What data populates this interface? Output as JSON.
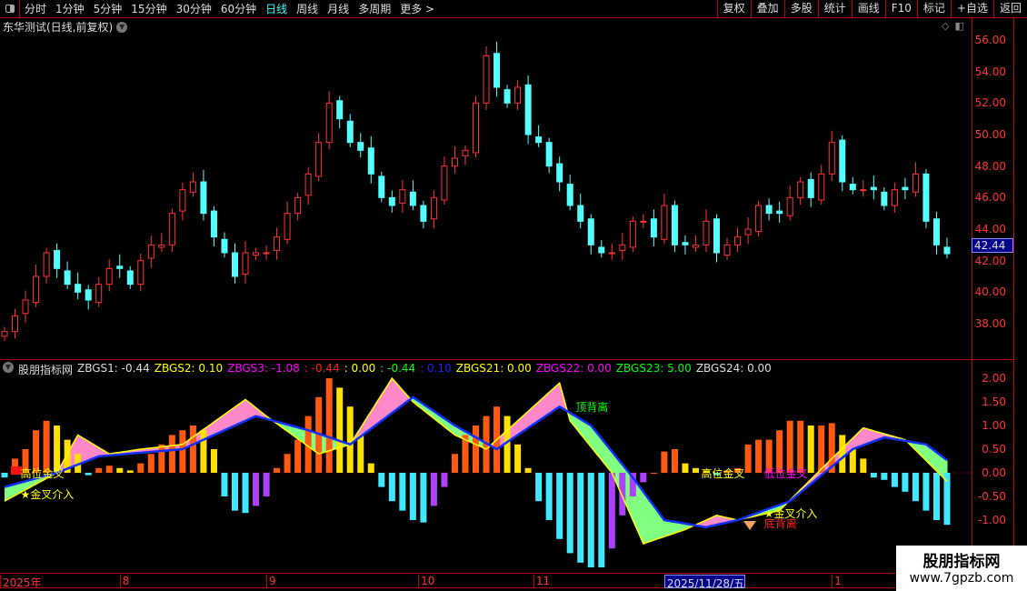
{
  "toolbar": {
    "periods": [
      "分时",
      "1分钟",
      "5分钟",
      "15分钟",
      "30分钟",
      "60分钟",
      "日线",
      "周线",
      "月线",
      "多周期",
      "更多 >"
    ],
    "active_period": "日线",
    "buttons": [
      "复权",
      "叠加",
      "多股",
      "统计",
      "画线",
      "F10",
      "标记",
      "+自选",
      "返回"
    ]
  },
  "chart": {
    "title": "东华测试(日线,前复权)",
    "current_price": "42.44",
    "price_ticks": [
      "56.00",
      "54.00",
      "52.00",
      "50.00",
      "48.00",
      "46.00",
      "44.00",
      "42.00",
      "40.00",
      "38.00"
    ],
    "price_range": [
      37,
      57.2
    ],
    "closes": [
      37.5,
      38.5,
      39.5,
      41,
      42.5,
      41.5,
      40.5,
      40,
      39.5,
      40.5,
      41.5,
      41.5,
      40.5,
      42,
      43,
      43,
      45,
      46.5,
      47,
      45,
      43.5,
      42.5,
      41,
      42.5,
      42.5,
      42.5,
      43.5,
      45,
      46,
      47.5,
      49.5,
      52,
      51,
      49.5,
      49,
      47.5,
      46,
      45.5,
      46.5,
      45.5,
      44.5,
      46,
      48,
      48.5,
      49,
      52,
      55,
      53,
      52,
      53,
      50,
      49.5,
      48,
      47,
      45.5,
      44.5,
      43,
      42.5,
      42.5,
      43,
      44.5,
      44.5,
      43.5,
      45.5,
      43,
      43,
      43,
      44.5,
      42.5,
      43,
      43.5,
      44,
      45.5,
      45,
      45,
      46,
      47,
      46,
      47.5,
      49.5,
      47,
      46.5,
      46.5,
      46.5,
      45.5,
      46.5,
      46.5,
      47.5,
      44.5,
      43,
      42.44
    ],
    "colors": {
      "up": "#ff3232",
      "down": "#54ffff"
    }
  },
  "indicator": {
    "name": "股朋指标网",
    "values": [
      {
        "label": "ZBGS1: -0.44",
        "color": "#dddddd"
      },
      {
        "label": "ZBGS2: 0.10",
        "color": "#ffff00"
      },
      {
        "label": "ZBGS3: -1.08",
        "color": "#ff00ff"
      },
      {
        "label": ": -0.44",
        "color": "#ff2020"
      },
      {
        "label": ": 0.00",
        "color": "#ffff00"
      },
      {
        "label": ": -0.44",
        "color": "#00ff00"
      },
      {
        "label": ": 0.10",
        "color": "#2020ff"
      },
      {
        "label": "ZBGS21: 0.00",
        "color": "#ffff00"
      },
      {
        "label": "ZBGS22: 0.00",
        "color": "#ff00ff"
      },
      {
        "label": "ZBGS23: 5.00",
        "color": "#00ff00"
      },
      {
        "label": "ZBGS24: 0.00",
        "color": "#dddddd"
      }
    ],
    "ticks": [
      "2.00",
      "1.50",
      "1.00",
      "0.50",
      "0.00",
      "-0.50",
      "-1.00"
    ],
    "range": [
      -2.1,
      2.2
    ],
    "histogram": [
      -0.1,
      0.3,
      0.5,
      0.9,
      1.1,
      1.0,
      0.7,
      0.4,
      -0.05,
      0.1,
      0.15,
      0.1,
      0.05,
      0.2,
      0.4,
      0.6,
      0.8,
      0.9,
      1.0,
      0.9,
      0.5,
      -0.5,
      -0.8,
      -0.85,
      -0.7,
      -0.5,
      0.1,
      0.4,
      0.7,
      1.2,
      1.6,
      2.0,
      1.8,
      1.4,
      0.8,
      0.2,
      -0.3,
      -0.6,
      -0.8,
      -1.0,
      -1.05,
      -0.7,
      -0.3,
      0.4,
      0.8,
      1.0,
      1.2,
      1.4,
      1.2,
      0.6,
      0.1,
      -0.6,
      -1.0,
      -1.4,
      -1.7,
      -1.9,
      -2.0,
      -2.0,
      -1.6,
      -0.9,
      -0.5,
      -0.2,
      0.0,
      0.45,
      0.5,
      0.2,
      0.1,
      0.05,
      -0.05,
      0.05,
      0.1,
      0.6,
      0.7,
      0.7,
      0.9,
      1.1,
      1.1,
      1.0,
      1.0,
      1.05,
      0.8,
      0.5,
      0.3,
      -0.1,
      -0.15,
      -0.3,
      -0.4,
      -0.6,
      -0.8,
      -1.0,
      -1.1
    ],
    "fast_line": [
      [
        0,
        -0.6
      ],
      [
        5,
        0.0
      ],
      [
        7,
        0.8
      ],
      [
        10,
        0.4
      ],
      [
        13,
        0.5
      ],
      [
        17,
        0.6
      ],
      [
        23,
        1.55
      ],
      [
        25,
        1.2
      ],
      [
        30,
        0.4
      ],
      [
        33,
        0.6
      ],
      [
        37,
        2.0
      ],
      [
        39,
        1.5
      ],
      [
        43,
        0.8
      ],
      [
        46,
        0.5
      ],
      [
        53,
        1.9
      ],
      [
        54,
        1.1
      ],
      [
        58,
        0.0
      ],
      [
        61,
        -1.5
      ],
      [
        65,
        -1.2
      ],
      [
        68,
        -0.9
      ],
      [
        70,
        -1.0
      ],
      [
        74,
        -0.8
      ],
      [
        79,
        0.3
      ],
      [
        82,
        0.95
      ],
      [
        86,
        0.7
      ],
      [
        91,
        -0.4
      ]
    ],
    "slow_line": [
      [
        0,
        -0.3
      ],
      [
        5,
        0
      ],
      [
        9,
        0.35
      ],
      [
        17,
        0.5
      ],
      [
        24,
        1.2
      ],
      [
        29,
        0.9
      ],
      [
        33,
        0.6
      ],
      [
        39,
        1.6
      ],
      [
        43,
        1.0
      ],
      [
        47,
        0.5
      ],
      [
        53,
        1.4
      ],
      [
        56,
        1.0
      ],
      [
        60,
        -0.1
      ],
      [
        63,
        -1.0
      ],
      [
        67,
        -1.15
      ],
      [
        70,
        -1.0
      ],
      [
        75,
        -0.6
      ],
      [
        81,
        0.5
      ],
      [
        84,
        0.75
      ],
      [
        88,
        0.6
      ],
      [
        91,
        0.1
      ]
    ],
    "signals": [
      {
        "text": "高位金叉",
        "color": "#ffff00",
        "value": 0.0,
        "bar": 1
      },
      {
        "text": "★金叉介入",
        "color": "#ffff00",
        "value": -0.45,
        "bar": 1
      },
      {
        "text": "顶背离",
        "color": "#00ff00",
        "value": 1.4,
        "bar": 54
      },
      {
        "text": "高位金叉",
        "color": "#ffff00",
        "value": 0.0,
        "bar": 66
      },
      {
        "text": "低位金叉",
        "color": "#ff00ff",
        "value": 0.0,
        "bar": 72
      },
      {
        "text": "★金叉介入",
        "color": "#ffff00",
        "value": -0.85,
        "bar": 72
      },
      {
        "text": "底背离",
        "color": "#ff2020",
        "value": -1.05,
        "bar": 72
      }
    ]
  },
  "time_axis": [
    {
      "label": "2025年",
      "bar": 0
    },
    {
      "label": "8",
      "bar": 11
    },
    {
      "label": "9",
      "bar": 25
    },
    {
      "label": "10",
      "bar": 39.5
    },
    {
      "label": "11",
      "bar": 50.5
    },
    {
      "label": "2025/11/28/五",
      "bar": 63,
      "highlight": true
    },
    {
      "label": "1",
      "bar": 79
    }
  ],
  "watermark": {
    "name": "股朋指标网",
    "url": "www.7gpzb.com"
  }
}
